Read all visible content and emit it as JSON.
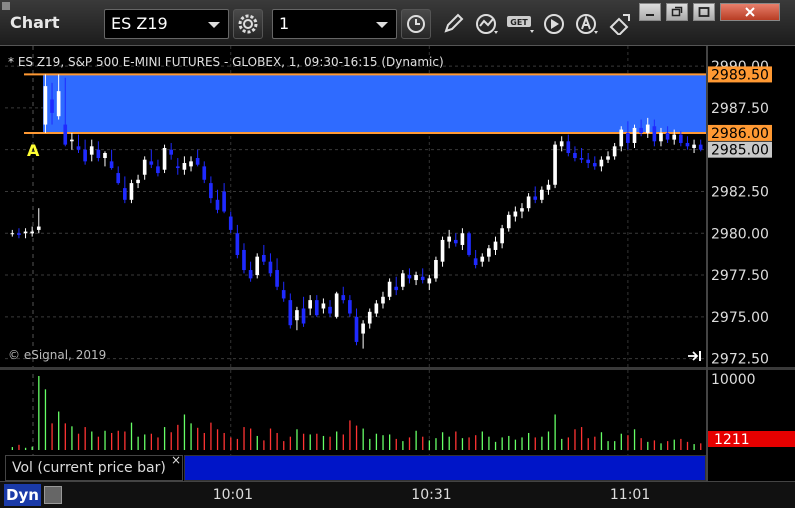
{
  "app": {
    "title": "Chart"
  },
  "toolbar": {
    "symbol": "ES Z19",
    "interval": "1"
  },
  "chart": {
    "legend": "* ES Z19, S&P 500 E-MINI FUTURES - GLOBEX, 1, 09:30-16:15 (Dynamic)",
    "copyright": "© eSignal, 2019",
    "marker": "A",
    "band_top_label": "2989.50",
    "band_bottom_label": "2986.00",
    "current_label": "2985.00",
    "volume_label": "1211",
    "volume_top": "10000",
    "volume_study": "Vol (current price bar)",
    "close_glyph": "×",
    "dyn": "Dyn",
    "colors": {
      "band": "#2f6bff",
      "band_line": "#ff9933",
      "up": "#ffffff",
      "down": "#1f2aff",
      "vol_up": "#66ff66",
      "vol_down": "#ff3333",
      "current_bg": "#c8c8c8",
      "volume_bg": "#e60000"
    }
  },
  "chart_data": {
    "type": "candlestick",
    "y_ticks": [
      "2990.00",
      "2987.50",
      "2985.00",
      "2982.50",
      "2980.00",
      "2977.50",
      "2975.00",
      "2972.50"
    ],
    "y_tick_values": [
      2990,
      2987.5,
      2985,
      2982.5,
      2980,
      2977.5,
      2975,
      2972.5
    ],
    "ylim": [
      2972.0,
      2991.2
    ],
    "x_ticks": [
      "10:01",
      "10:31",
      "11:01"
    ],
    "x_tick_index": [
      33,
      63,
      93
    ],
    "band": [
      2986.0,
      2989.5
    ],
    "current": 2985.0,
    "vol_max": 10000,
    "ohlc": [
      [
        2980.0,
        2980.2,
        2979.8,
        2980.0
      ],
      [
        2980.0,
        2980.3,
        2979.7,
        2979.9
      ],
      [
        2980.0,
        2980.3,
        2979.7,
        2980.1
      ],
      [
        2980.0,
        2980.4,
        2979.8,
        2980.1
      ],
      [
        2980.2,
        2981.5,
        2980.0,
        2980.4
      ],
      [
        2986.5,
        2989.5,
        2986.0,
        2988.8
      ],
      [
        2988.0,
        2989.0,
        2986.5,
        2987.2
      ],
      [
        2987.0,
        2989.5,
        2986.8,
        2988.5
      ],
      [
        2986.5,
        2989.3,
        2985.2,
        2985.3
      ],
      [
        2985.5,
        2986.0,
        2985.0,
        2985.6
      ],
      [
        2985.2,
        2985.9,
        2984.8,
        2985.0
      ],
      [
        2985.0,
        2985.6,
        2984.1,
        2984.3
      ],
      [
        2984.7,
        2985.6,
        2984.3,
        2985.2
      ],
      [
        2985.0,
        2985.5,
        2984.3,
        2984.5
      ],
      [
        2984.5,
        2984.9,
        2984.0,
        2984.8
      ],
      [
        2984.3,
        2985.0,
        2983.8,
        2983.9
      ],
      [
        2983.6,
        2984.0,
        2982.9,
        2983.0
      ],
      [
        2982.7,
        2983.4,
        2981.8,
        2982.0
      ],
      [
        2982.0,
        2983.2,
        2981.8,
        2983.0
      ],
      [
        2983.0,
        2983.5,
        2982.7,
        2983.2
      ],
      [
        2983.5,
        2984.6,
        2983.2,
        2984.4
      ],
      [
        2984.3,
        2985.0,
        2983.9,
        2984.1
      ],
      [
        2984.0,
        2984.4,
        2983.4,
        2983.6
      ],
      [
        2983.8,
        2985.3,
        2983.6,
        2985.1
      ],
      [
        2985.0,
        2985.4,
        2984.4,
        2984.7
      ],
      [
        2984.0,
        2984.5,
        2983.5,
        2983.9
      ],
      [
        2983.8,
        2984.6,
        2983.5,
        2984.2
      ],
      [
        2984.0,
        2984.6,
        2983.7,
        2984.3
      ],
      [
        2984.5,
        2985.0,
        2984.0,
        2984.1
      ],
      [
        2984.0,
        2984.3,
        2983.0,
        2983.2
      ],
      [
        2983.0,
        2983.4,
        2981.8,
        2982.1
      ],
      [
        2982.0,
        2982.6,
        2981.2,
        2981.4
      ],
      [
        2982.5,
        2983.0,
        2981.2,
        2981.3
      ],
      [
        2981.0,
        2981.3,
        2980.0,
        2980.2
      ],
      [
        2980.0,
        2980.5,
        2978.5,
        2978.7
      ],
      [
        2979.0,
        2979.4,
        2977.6,
        2977.8
      ],
      [
        2977.8,
        2978.3,
        2977.1,
        2977.3
      ],
      [
        2977.5,
        2978.8,
        2977.3,
        2978.6
      ],
      [
        2978.7,
        2979.3,
        2978.1,
        2978.3
      ],
      [
        2978.3,
        2978.8,
        2977.4,
        2977.6
      ],
      [
        2977.8,
        2978.5,
        2976.6,
        2976.8
      ],
      [
        2976.6,
        2977.1,
        2975.9,
        2976.1
      ],
      [
        2976.0,
        2976.4,
        2974.3,
        2974.5
      ],
      [
        2974.8,
        2975.6,
        2974.2,
        2975.4
      ],
      [
        2975.5,
        2976.2,
        2974.4,
        2974.6
      ],
      [
        2975.5,
        2976.3,
        2975.1,
        2976.0
      ],
      [
        2976.0,
        2976.3,
        2975.0,
        2975.1
      ],
      [
        2975.5,
        2976.1,
        2975.2,
        2975.8
      ],
      [
        2975.6,
        2976.0,
        2975.0,
        2975.2
      ],
      [
        2975.0,
        2976.5,
        2974.9,
        2976.4
      ],
      [
        2976.3,
        2976.8,
        2975.8,
        2976.0
      ],
      [
        2976.0,
        2976.3,
        2975.0,
        2975.2
      ],
      [
        2975.0,
        2975.5,
        2973.3,
        2973.5
      ],
      [
        2974.0,
        2974.8,
        2973.1,
        2974.6
      ],
      [
        2974.6,
        2975.5,
        2974.3,
        2975.3
      ],
      [
        2975.2,
        2976.0,
        2975.0,
        2975.8
      ],
      [
        2975.8,
        2976.5,
        2975.5,
        2976.2
      ],
      [
        2976.2,
        2977.3,
        2976.0,
        2977.1
      ],
      [
        2976.8,
        2977.4,
        2976.3,
        2976.6
      ],
      [
        2976.8,
        2977.8,
        2976.6,
        2977.6
      ],
      [
        2977.5,
        2977.9,
        2977.0,
        2977.3
      ],
      [
        2977.2,
        2977.7,
        2976.9,
        2977.5
      ],
      [
        2977.4,
        2977.9,
        2977.0,
        2977.2
      ],
      [
        2977.0,
        2977.5,
        2976.6,
        2977.3
      ],
      [
        2977.3,
        2978.6,
        2977.1,
        2978.4
      ],
      [
        2978.3,
        2979.8,
        2978.0,
        2979.6
      ],
      [
        2979.5,
        2980.2,
        2979.1,
        2979.8
      ],
      [
        2979.6,
        2980.0,
        2979.2,
        2979.4
      ],
      [
        2979.3,
        2980.3,
        2979.0,
        2980.0
      ],
      [
        2980.0,
        2980.1,
        2978.6,
        2978.7
      ],
      [
        2978.5,
        2979.0,
        2977.9,
        2978.1
      ],
      [
        2978.3,
        2978.8,
        2978.0,
        2978.6
      ],
      [
        2978.6,
        2979.3,
        2978.3,
        2979.1
      ],
      [
        2979.0,
        2979.8,
        2978.7,
        2979.5
      ],
      [
        2979.4,
        2980.5,
        2979.1,
        2980.3
      ],
      [
        2980.3,
        2981.3,
        2980.1,
        2981.1
      ],
      [
        2981.0,
        2981.6,
        2980.7,
        2981.3
      ],
      [
        2981.3,
        2981.8,
        2980.9,
        2981.5
      ],
      [
        2981.5,
        2982.4,
        2981.3,
        2982.2
      ],
      [
        2982.2,
        2982.8,
        2981.8,
        2982.0
      ],
      [
        2982.0,
        2982.8,
        2981.8,
        2982.6
      ],
      [
        2982.6,
        2983.2,
        2982.3,
        2982.9
      ],
      [
        2982.9,
        2985.5,
        2982.7,
        2985.3
      ],
      [
        2985.2,
        2985.8,
        2984.9,
        2985.5
      ],
      [
        2985.5,
        2985.9,
        2984.6,
        2984.8
      ],
      [
        2984.8,
        2985.2,
        2984.3,
        2984.5
      ],
      [
        2984.5,
        2985.1,
        2984.2,
        2984.4
      ],
      [
        2984.4,
        2984.8,
        2983.9,
        2984.2
      ],
      [
        2984.2,
        2984.6,
        2983.8,
        2984.0
      ],
      [
        2984.0,
        2984.6,
        2983.7,
        2984.4
      ],
      [
        2984.4,
        2984.9,
        2984.2,
        2984.6
      ],
      [
        2984.6,
        2985.4,
        2984.4,
        2985.2
      ],
      [
        2985.2,
        2986.4,
        2984.9,
        2986.2
      ],
      [
        2986.0,
        2986.7,
        2985.0,
        2985.4
      ],
      [
        2985.4,
        2986.5,
        2985.1,
        2986.3
      ],
      [
        2986.3,
        2986.8,
        2985.8,
        2986.0
      ],
      [
        2986.0,
        2986.9,
        2985.7,
        2986.5
      ],
      [
        2986.4,
        2986.8,
        2985.2,
        2985.5
      ],
      [
        2985.5,
        2986.3,
        2985.2,
        2986.0
      ],
      [
        2986.0,
        2986.4,
        2985.4,
        2985.6
      ],
      [
        2985.6,
        2986.2,
        2985.3,
        2985.9
      ],
      [
        2985.9,
        2986.1,
        2985.2,
        2985.4
      ],
      [
        2985.4,
        2985.8,
        2985.0,
        2985.2
      ],
      [
        2985.1,
        2985.6,
        2984.8,
        2985.3
      ],
      [
        2985.3,
        2985.6,
        2984.9,
        2985.0
      ]
    ],
    "volume": [
      400,
      700,
      300,
      450,
      10000,
      8200,
      3600,
      5200,
      3600,
      3200,
      2200,
      3100,
      2500,
      1800,
      2600,
      2300,
      2600,
      2500,
      3700,
      1800,
      2100,
      2200,
      1700,
      3100,
      2400,
      3400,
      4800,
      3600,
      3000,
      2300,
      3700,
      2800,
      2300,
      1700,
      1500,
      3100,
      2900,
      1900,
      1300,
      2900,
      2300,
      1200,
      1800,
      2800,
      2200,
      2100,
      2200,
      1900,
      1800,
      2500,
      2100,
      4000,
      3300,
      2900,
      1500,
      2200,
      2000,
      2100,
      1500,
      1200,
      1700,
      2600,
      1800,
      1300,
      1600,
      2400,
      1800,
      2500,
      1600,
      1700,
      2000,
      2500,
      1800,
      1100,
      1700,
      1900,
      1400,
      1700,
      2300,
      1700,
      1800,
      2500,
      4800,
      1500,
      1700,
      2800,
      3100,
      1600,
      1800,
      2400,
      1200,
      1200,
      2200,
      2000,
      2800,
      1600,
      1100,
      1300,
      900,
      1200,
      1400,
      1500,
      1100,
      800,
      900
    ]
  }
}
